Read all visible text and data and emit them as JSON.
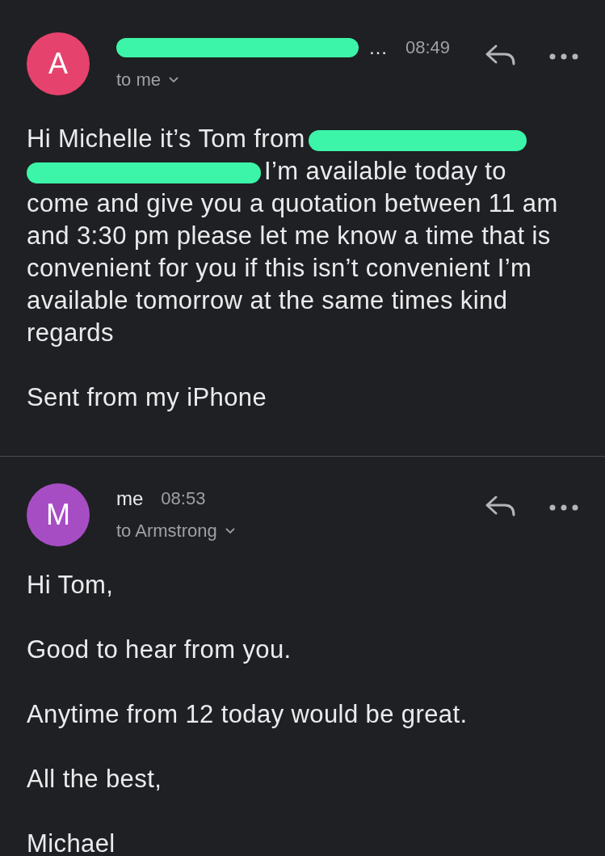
{
  "messages": [
    {
      "avatar": "A",
      "color": "#e5436d",
      "sender": "…",
      "sender_redacted": true,
      "time": "08:49",
      "recipient": "to me",
      "body": [
        [
          {
            "kind": "text",
            "text": "Hi Michelle it’s Tom from"
          },
          {
            "kind": "redaction"
          },
          {
            "kind": "redaction"
          },
          {
            "kind": "text",
            "text": "I’m available today to"
          },
          {
            "kind": "line",
            "text": "come and give you a quotation between 11 am and 3:30 pm please let me know a time that is convenient for you if this isn’t convenient I’m available tomorrow at the same times kind regards"
          }
        ],
        [
          {
            "kind": "text",
            "text": "Sent from my iPhone"
          }
        ]
      ]
    },
    {
      "avatar": "M",
      "color": "#a74dc4",
      "sender": "me",
      "sender_redacted": false,
      "time": "08:53",
      "recipient": "to Armstrong",
      "body": [
        [
          {
            "kind": "text",
            "text": "Hi Tom,"
          }
        ],
        [
          {
            "kind": "text",
            "text": "Good to hear from you."
          }
        ],
        [
          {
            "kind": "text",
            "text": "Anytime from 12 today would be great."
          }
        ],
        [
          {
            "kind": "text",
            "text": "All the best,"
          }
        ],
        [
          {
            "kind": "text",
            "text": "Michael"
          }
        ]
      ]
    }
  ]
}
